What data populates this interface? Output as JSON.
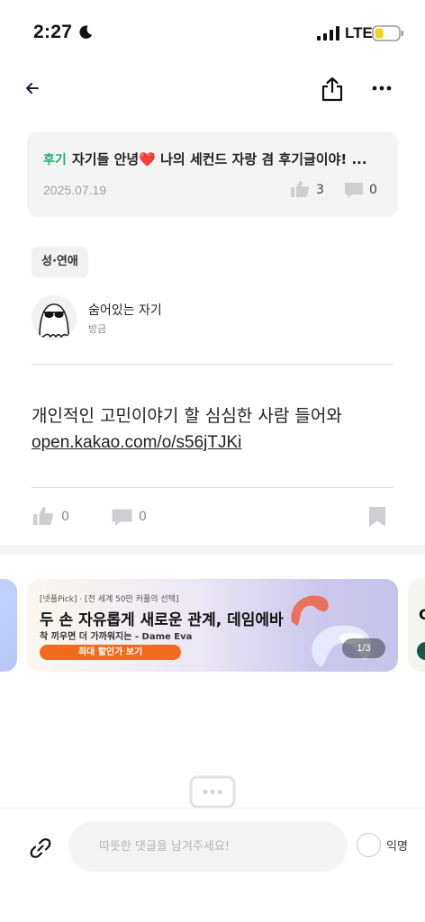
{
  "status_bar": {
    "time": "2:27",
    "network": "LTE",
    "battery_color": "#f4d21c"
  },
  "nav": {
    "back_icon": "arrow-left-icon",
    "share_icon": "share-icon",
    "more_icon": "more-horizontal-icon"
  },
  "ref_post": {
    "tag": "후기",
    "title": "자기들 안녕❤️ 나의 세컨드 자랑 겸 후기글이야! ...",
    "date": "2025.07.19",
    "likes": "3",
    "comments": "0"
  },
  "post": {
    "category": "성·연애",
    "author": "숨어있는 자기",
    "time": "방금",
    "body": "개인적인 고민이야기 할 심심한 사람 들어와",
    "link": "open.kakao.com/o/s56jTJKi",
    "likes": "0",
    "comments": "0"
  },
  "banner": {
    "kicker": "[넷플Pick] · [전 세계 50만 커플의 선택]",
    "headline": "두 손 자유롭게 새로운 관계, 데임에바",
    "sub": "착 끼우면 더 가까워지는 - Dame Eva",
    "cta": "최대 할인가 보기",
    "page": "1/3",
    "next_partial": "C",
    "cta_color": "#f26b1d"
  },
  "comment_bar": {
    "placeholder": "따뜻한 댓글을 남겨주세요!",
    "anonymous_label": "익명"
  },
  "colors": {
    "accent_green": "#1fb06b",
    "heart_red": "#e5393a"
  }
}
